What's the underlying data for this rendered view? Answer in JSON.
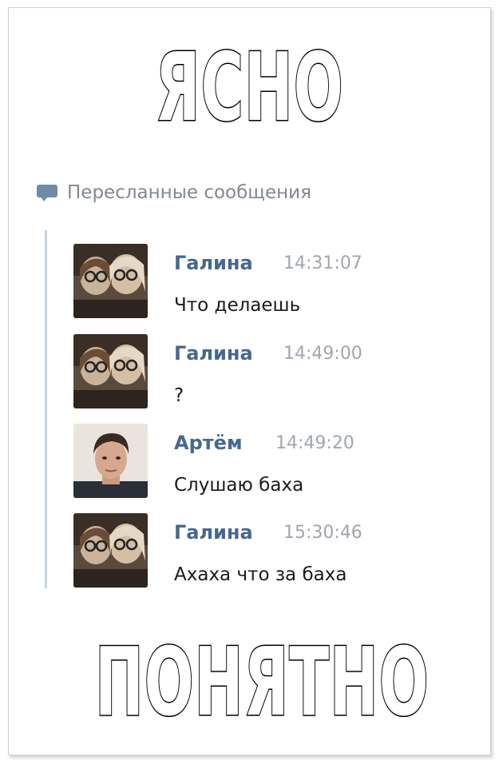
{
  "meme": {
    "top_text": "ЯСНО",
    "bottom_text": "ПОНЯТНО"
  },
  "forwarded": {
    "label": "Пересланные сообщения",
    "icon": "speech-bubble-icon"
  },
  "messages": [
    {
      "author": "Галина",
      "time": "14:31:07",
      "text": "Что делаешь",
      "avatar": "two-girls-photo"
    },
    {
      "author": "Галина",
      "time": "14:49:00",
      "text": "?",
      "avatar": "two-girls-photo"
    },
    {
      "author": "Артём",
      "time": "14:49:20",
      "text": "Слушаю баха",
      "avatar": "young-man-photo"
    },
    {
      "author": "Галина",
      "time": "15:30:46",
      "text": "Ахаха что за баха",
      "avatar": "two-girls-photo"
    }
  ],
  "colors": {
    "name": "#45688e",
    "time": "#a0a6ad",
    "thread_line": "#c8d4df",
    "icon": "#6f8ba8"
  }
}
